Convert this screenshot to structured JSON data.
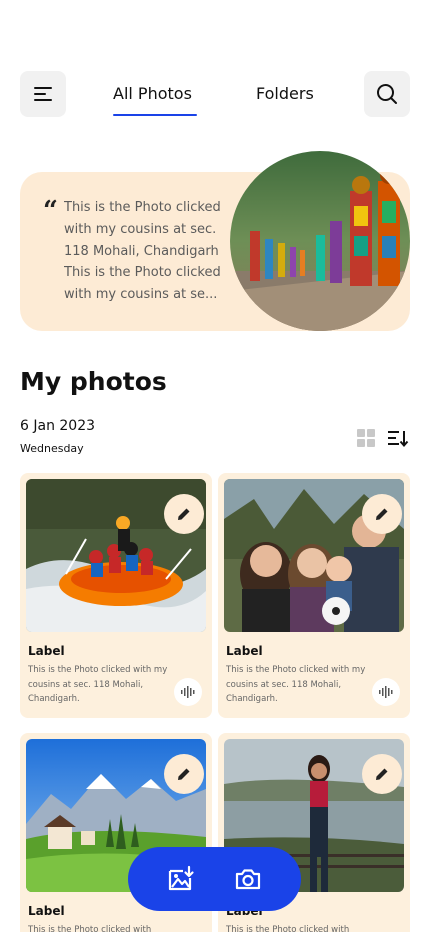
{
  "header": {
    "menu_icon": "hamburger-menu-icon",
    "search_icon": "search-icon",
    "tabs": [
      {
        "label": "All Photos",
        "active": true
      },
      {
        "label": "Folders",
        "active": false
      }
    ],
    "accent_color": "#1a43e8"
  },
  "featured": {
    "quote_mark": "“",
    "text": "This is the Photo clicked with my cousins at sec. 118 Mohali, Chandigarh This is the Photo clicked with my cousins at se...",
    "background_color": "#fdebd5"
  },
  "section": {
    "title": "My photos",
    "date": "6 Jan 2023",
    "day": "Wednesday",
    "grid_icon": "grid-view-icon",
    "sort_icon": "sort-icon"
  },
  "photos": [
    {
      "label": "Label",
      "description": "This is the Photo clicked with my cousins at sec. 118 Mohali, Chandigarh.",
      "image": "river-rafting-photo"
    },
    {
      "label": "Label",
      "description": "This is the Photo clicked with my cousins at sec. 118 Mohali, Chandigarh.",
      "image": "family-photo"
    },
    {
      "label": "Label",
      "description": "This is the Photo clicked with",
      "image": "mountain-landscape-photo"
    },
    {
      "label": "Label",
      "description": "This is the Photo clicked with",
      "image": "woman-at-lake-photo"
    }
  ],
  "fab": {
    "gallery_icon": "add-photo-icon",
    "camera_icon": "camera-icon",
    "color": "#1a43e8"
  }
}
